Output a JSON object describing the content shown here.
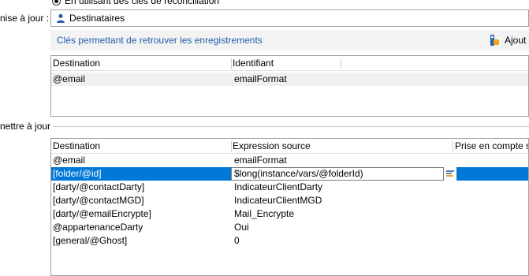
{
  "radio_option": {
    "label": "En utilisant des clés de réconciliation"
  },
  "target": {
    "label": "nise à jour :",
    "value": "Destinataires"
  },
  "keys_section": {
    "title": "Clés permettant de retrouver les enregistrements",
    "add_label": "Ajout"
  },
  "keys_table": {
    "columns": [
      "Destination",
      "Identifiant"
    ],
    "rows": [
      {
        "destination": "@email",
        "identifier": "emailFormat"
      }
    ]
  },
  "fields_group": {
    "label": "nettre à jour"
  },
  "fields_table": {
    "columns": [
      "Destination",
      "Expression source",
      "Prise en compte s"
    ],
    "rows": [
      {
        "destination": "@email",
        "expression": "emailFormat"
      },
      {
        "destination": "[folder/@id]",
        "expression": "$long(instance/vars/@folderId)",
        "selected": true
      },
      {
        "destination": "[darty/@contactDarty]",
        "expression": "IndicateurClientDarty"
      },
      {
        "destination": "[darty/@contactMGD]",
        "expression": "IndicateurClientMGD"
      },
      {
        "destination": "[darty/@emailEncrypte]",
        "expression": "Mail_Encrypte"
      },
      {
        "destination": "@appartenanceDarty",
        "expression": "Oui"
      },
      {
        "destination": "[general/@Ghost]",
        "expression": "0"
      }
    ]
  },
  "colors": {
    "selection": "#0078d7",
    "link": "#1f5ea8"
  }
}
